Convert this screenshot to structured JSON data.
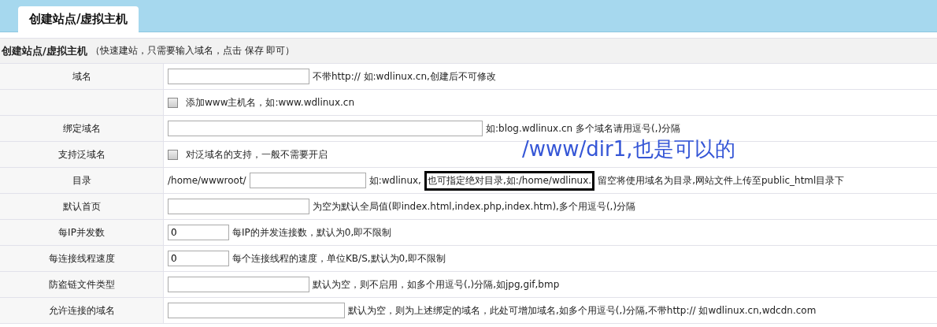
{
  "tabs": [
    {
      "label": "创建站点/虚拟主机",
      "selected": true
    }
  ],
  "form": {
    "title": "创建站点/虚拟主机",
    "subtitle": "（快速建站，只需要输入域名，点击 保存 即可）",
    "rows": [
      {
        "kind": "text",
        "label": "域名",
        "value": "",
        "hint": "不带http:// 如:wdlinux.cn,创建后不可修改"
      },
      {
        "kind": "checkbox",
        "label": "",
        "checked": false,
        "hint": "添加www主机名，如:www.wdlinux.cn"
      },
      {
        "kind": "list",
        "label": "绑定域名",
        "value": "",
        "hint": "如:blog.wdlinux.cn 多个域名请用逗号(,)分隔"
      },
      {
        "kind": "checkbox",
        "label": "支持泛域名",
        "checked": false,
        "hint": "对泛域名的支持，一般不需要开启"
      },
      {
        "kind": "path",
        "label": "目录",
        "prefix": "/home/wwwroot/",
        "value": "",
        "hint": "如:wdlinux,",
        "highlight": "也可指定绝对目录,如:/home/wdlinux.",
        "hint_after": "留空将使用域名为目录,网站文件上传至public_html目录下"
      },
      {
        "kind": "text",
        "label": "默认首页",
        "value": "",
        "hint": "为空为默认全局值(即index.html,index.php,index.htm),多个用逗号(,)分隔"
      },
      {
        "kind": "number",
        "label": "每IP并发数",
        "value": "0",
        "hint": "每IP的并发连接数，默认为0,即不限制"
      },
      {
        "kind": "number",
        "label": "每连接线程速度",
        "value": "0",
        "hint": "每个连接线程的速度，单位KB/S,默认为0,即不限制"
      },
      {
        "kind": "text",
        "label": "防盗链文件类型",
        "value": "",
        "hint": "默认为空，则不启用，如多个用逗号(,)分隔,如jpg,gif,bmp"
      },
      {
        "kind": "wide",
        "label": "允许连接的域名",
        "value": "",
        "hint": "默认为空，则为上述绑定的域名，此处可增加域名,如多个用逗号(,)分隔,不带http:// 如wdlinux.cn,wdcdn.com"
      }
    ]
  },
  "annotation": {
    "text": "/www/dir1,也是可以的"
  }
}
